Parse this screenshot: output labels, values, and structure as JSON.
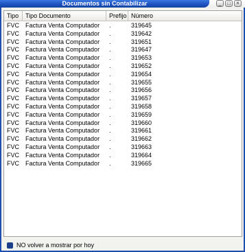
{
  "window": {
    "title": "Documentos sin Contabilizar",
    "minimize_glyph": "_",
    "maximize_glyph": "□",
    "close_glyph": "×"
  },
  "table": {
    "columns": [
      "Tipo",
      "Tipo Documento",
      "Prefijo",
      "Número"
    ],
    "rows": [
      {
        "tipo": "FVC",
        "doc": "Factura Venta Computador",
        "prefijo": ".",
        "numero": "319645"
      },
      {
        "tipo": "FVC",
        "doc": "Factura Venta Computador",
        "prefijo": ".",
        "numero": "319642"
      },
      {
        "tipo": "FVC",
        "doc": "Factura Venta Computador",
        "prefijo": ".",
        "numero": "319651"
      },
      {
        "tipo": "FVC",
        "doc": "Factura Venta Computador",
        "prefijo": ".",
        "numero": "319647"
      },
      {
        "tipo": "FVC",
        "doc": "Factura Venta Computador",
        "prefijo": ".",
        "numero": "319653"
      },
      {
        "tipo": "FVC",
        "doc": "Factura Venta Computador",
        "prefijo": ".",
        "numero": "319652"
      },
      {
        "tipo": "FVC",
        "doc": "Factura Venta Computador",
        "prefijo": ".",
        "numero": "319654"
      },
      {
        "tipo": "FVC",
        "doc": "Factura Venta Computador",
        "prefijo": ".",
        "numero": "319655"
      },
      {
        "tipo": "FVC",
        "doc": "Factura Venta Computador",
        "prefijo": ".",
        "numero": "319656"
      },
      {
        "tipo": "FVC",
        "doc": "Factura Venta Computador",
        "prefijo": ".",
        "numero": "319657"
      },
      {
        "tipo": "FVC",
        "doc": "Factura Venta Computador",
        "prefijo": ".",
        "numero": "319658"
      },
      {
        "tipo": "FVC",
        "doc": "Factura Venta Computador",
        "prefijo": ".",
        "numero": "319659"
      },
      {
        "tipo": "FVC",
        "doc": "Factura Venta Computador",
        "prefijo": ".",
        "numero": "319660"
      },
      {
        "tipo": "FVC",
        "doc": "Factura Venta Computador",
        "prefijo": ".",
        "numero": "319661"
      },
      {
        "tipo": "FVC",
        "doc": "Factura Venta Computador",
        "prefijo": ".",
        "numero": "319662"
      },
      {
        "tipo": "FVC",
        "doc": "Factura Venta Computador",
        "prefijo": ".",
        "numero": "319663"
      },
      {
        "tipo": "FVC",
        "doc": "Factura Venta Computador",
        "prefijo": ".",
        "numero": "319664"
      },
      {
        "tipo": "FVC",
        "doc": "Factura Venta Computador",
        "prefijo": ".",
        "numero": "319665"
      }
    ]
  },
  "footer": {
    "checkbox_label": "NO volver a mostrar por hoy",
    "checked": true
  },
  "colors": {
    "title_bar": "#1b50bf",
    "window_border": "#1d4fb0",
    "checkbox_fill": "#1c3f8a"
  }
}
